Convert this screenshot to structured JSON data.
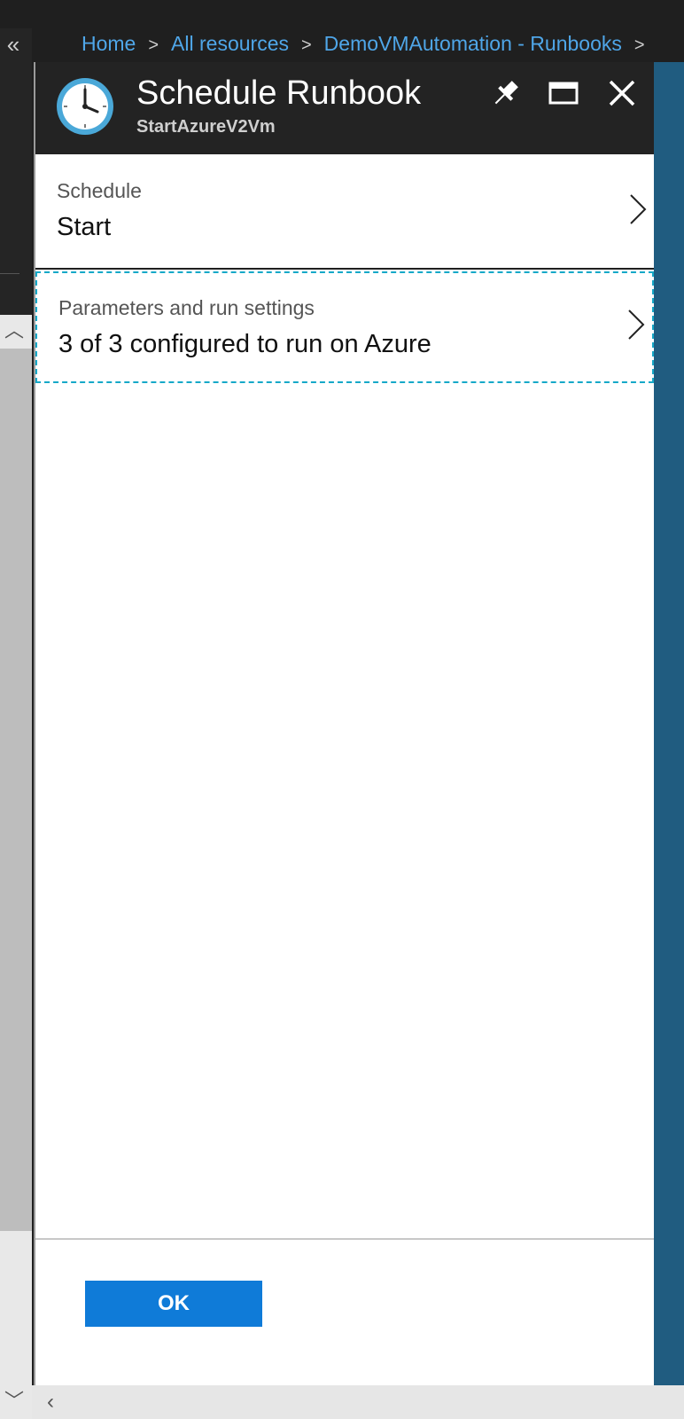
{
  "breadcrumb": {
    "items": [
      "Home",
      "All resources",
      "DemoVMAutomation - Runbooks"
    ],
    "separator": ">"
  },
  "blade": {
    "title": "Schedule Runbook",
    "subtitle": "StartAzureV2Vm",
    "icon": "clock-icon",
    "header_buttons": [
      "pin-icon",
      "maximize-icon",
      "close-icon"
    ]
  },
  "rows": [
    {
      "label": "Schedule",
      "value": "Start"
    },
    {
      "label": "Parameters and run settings",
      "value": "3 of 3 configured to run on Azure"
    }
  ],
  "footer": {
    "ok_label": "OK"
  },
  "colors": {
    "accent": "#0f7bd8",
    "link": "#4fa6e8",
    "header_bg": "#232323",
    "focus_outline": "#15a8c8"
  }
}
